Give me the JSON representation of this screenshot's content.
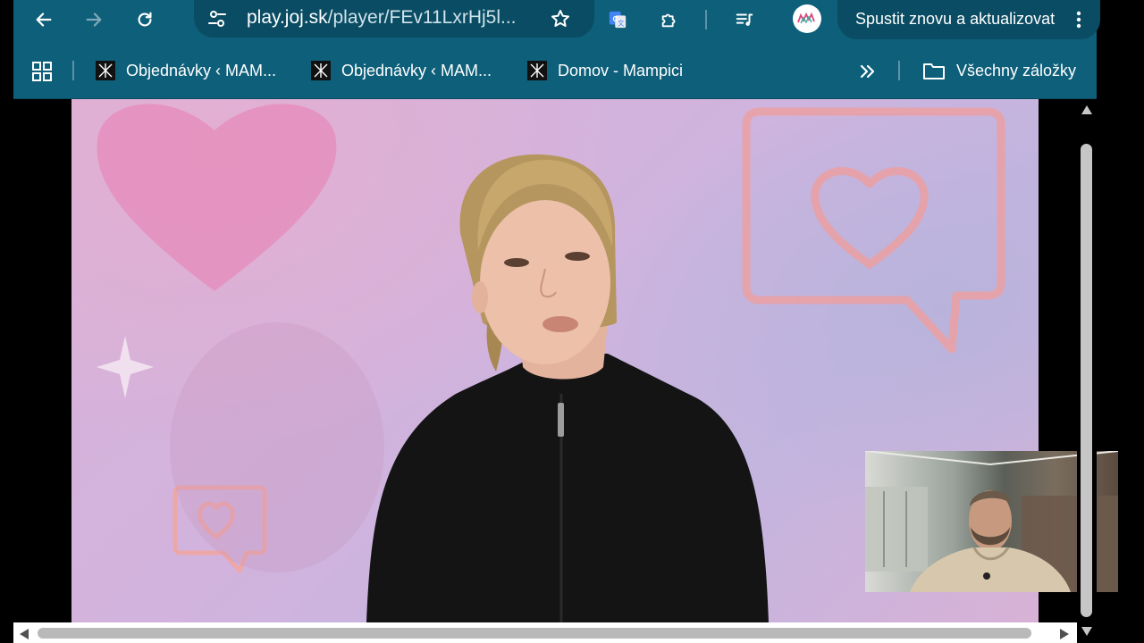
{
  "browser": {
    "url_host": "play.joj.sk",
    "url_path": "/player/FEv11LxrHj5l...",
    "update_label": "Spustit znovu a aktualizovat",
    "theme_color": "#0e5f7a"
  },
  "bookmarks": {
    "items": [
      {
        "label": "Objednávky ‹ MAM..."
      },
      {
        "label": "Objednávky ‹ MAM..."
      },
      {
        "label": "Domov - Mampici"
      }
    ],
    "all_bookmarks_label": "Všechny záložky"
  },
  "icons": {
    "back": "arrow-left-icon",
    "forward": "arrow-right-icon",
    "reload": "reload-icon",
    "site_info": "tune-icon",
    "bookmark_star": "star-icon",
    "translate": "google-translate-icon",
    "extensions": "puzzle-icon",
    "reading_list": "playlist-icon",
    "menu": "kebab-icon",
    "apps": "apps-grid-icon",
    "overflow": "chevron-double-right-icon",
    "folder": "folder-icon"
  },
  "video": {
    "background_color": "#d4b3da",
    "accent_pink": "#e58fbd",
    "accent_coral": "#e9a1a6"
  }
}
